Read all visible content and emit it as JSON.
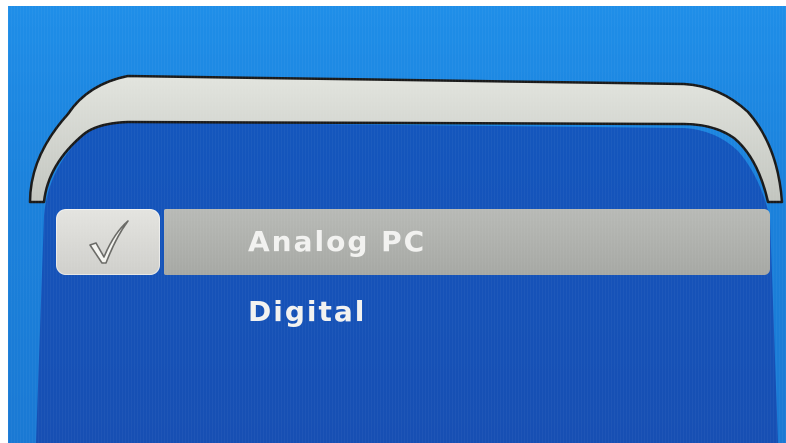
{
  "menu": {
    "items": [
      {
        "label": "Analog PC",
        "selected": true
      },
      {
        "label": "Digital",
        "selected": false
      }
    ],
    "selected_icon": "checkmark-icon"
  },
  "colors": {
    "background": "#1b82dc",
    "panel": "#1650b8",
    "frame": "#d3d5cf",
    "highlight": "#a9aba7",
    "text": "#f2f2f0"
  }
}
